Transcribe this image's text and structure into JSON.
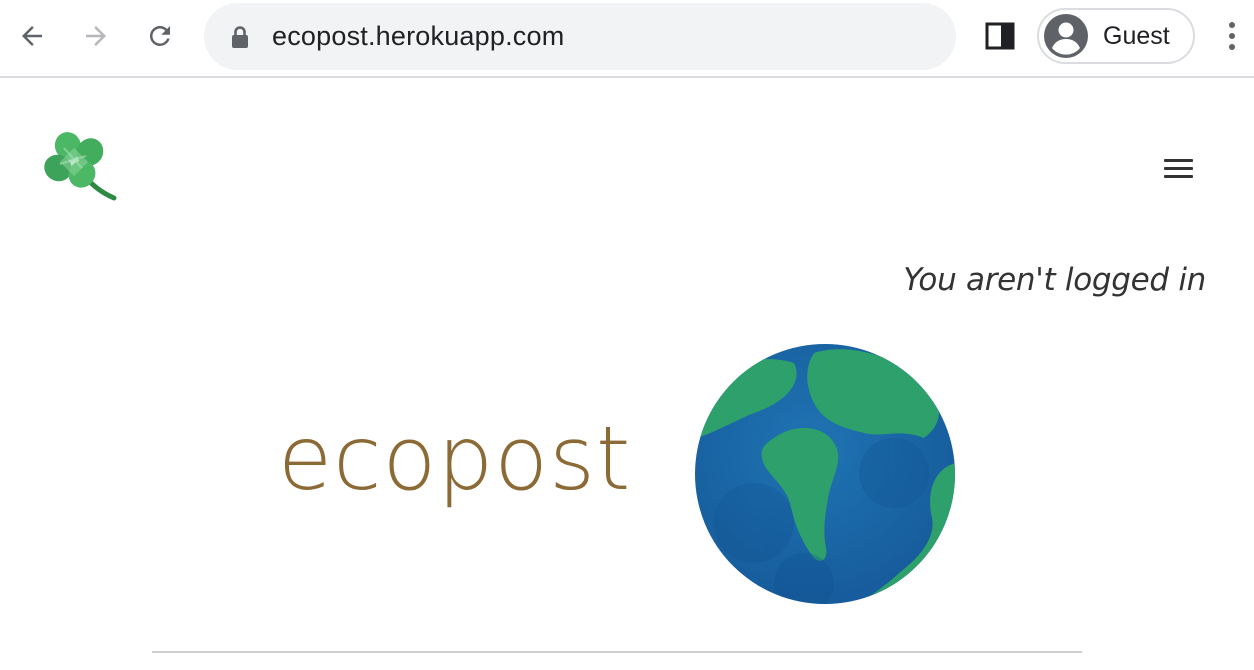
{
  "browser": {
    "url": "ecopost.herokuapp.com",
    "profile_label": "Guest"
  },
  "page": {
    "login_status": "You aren't logged in",
    "brand_name": "ecopost"
  },
  "icons": {
    "back": "back-arrow-icon",
    "forward": "forward-arrow-icon",
    "reload": "reload-icon",
    "lock": "lock-icon",
    "side_panel": "side-panel-icon",
    "avatar": "avatar-icon",
    "menu": "more-vert-icon",
    "logo": "clover-icon",
    "nav": "hamburger-menu-icon",
    "earth": "earth-globe-icon"
  },
  "colors": {
    "brand_text": "#8b6a35",
    "ocean": "#1e6aa8",
    "land": "#2fa36b",
    "clover": "#3fae5a"
  }
}
